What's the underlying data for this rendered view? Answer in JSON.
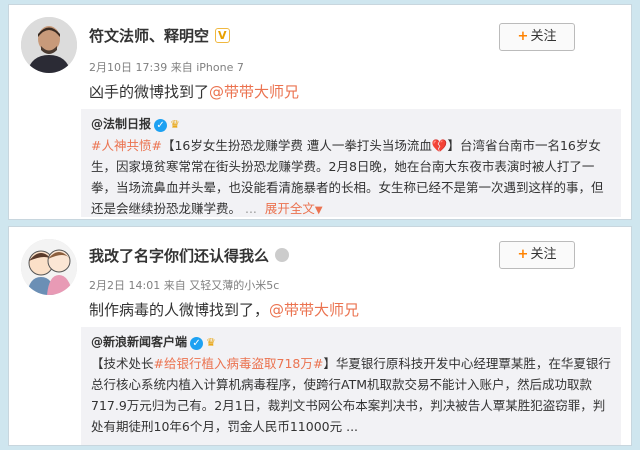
{
  "post1": {
    "username": "符文法师、释明空",
    "vip_label": "V",
    "follow_label": "关注",
    "date": "2月10日 17:39",
    "source_prefix": "来自",
    "source": "iPhone 7",
    "text": "凶手的微博找到了",
    "mention": "@带带大师兄",
    "repost": {
      "user": "@法制日报",
      "hashtag": "#人神共愤#",
      "headline": "【16岁女生扮恐龙赚学费 遭人一拳打头当场流血",
      "headline_end": "】",
      "body": "台湾省台南市一名16岁女生，因家境贫寒常常在街头扮恐龙赚学费。2月8日晚，她在台南大东夜市表演时被人打了一拳，当场流鼻血并头晕，也没能看清施暴者的长相。女生称已经不是第一次遇到这样的事，但还是会继续扮恐龙赚学费。",
      "expand": "展开全文"
    }
  },
  "post2": {
    "username": "我改了名字你们还认得我么",
    "follow_label": "关注",
    "date": "2月2日 14:01",
    "source_prefix": "来自",
    "source": "又轻又薄的小米5c",
    "text": "制作病毒的人微博找到了，",
    "mention": "@带带大师兄",
    "repost": {
      "user": "@新浪新闻客户端",
      "headline_open": "【技术处长",
      "hashtag": "#给银行植入病毒盗取718万#",
      "headline_close": "】",
      "body": "华夏银行原科技开发中心经理覃某胜，在华夏银行总行核心系统内植入计算机病毒程序，使跨行ATM机取款交易不能计入账户，然后成功取款717.9万元归为己有。2月1日，裁判文书网公布本案判决书，判决被告人覃某胜犯盗窃罪，判处有期徒刑10年6个月，罚金人民币11000元 ..."
    }
  }
}
